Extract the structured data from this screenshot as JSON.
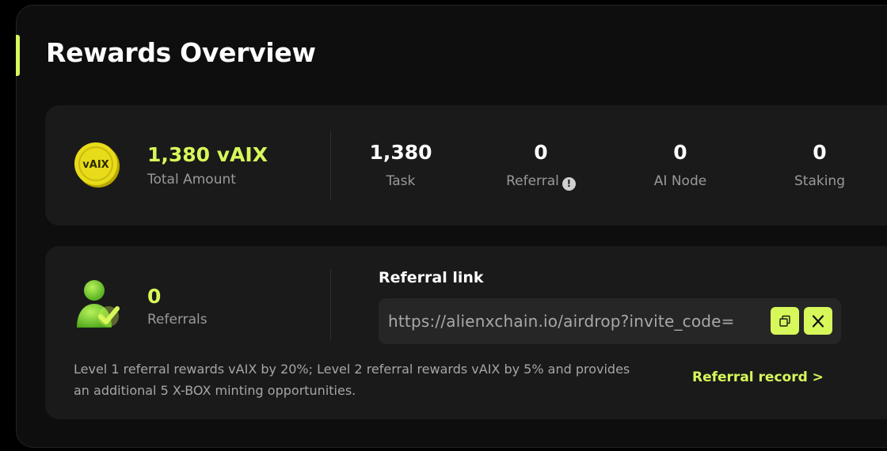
{
  "page": {
    "title": "Rewards Overview"
  },
  "rewards": {
    "total_amount": "1,380 vAIX",
    "total_label": "Total Amount",
    "coin_text": "vAIX",
    "stats": [
      {
        "value": "1,380",
        "label": "Task"
      },
      {
        "value": "0",
        "label": "Referral"
      },
      {
        "value": "0",
        "label": "AI Node"
      },
      {
        "value": "0",
        "label": "Staking"
      }
    ]
  },
  "referral": {
    "count": "0",
    "count_label": "Referrals",
    "link_title": "Referral link",
    "link_value": "https://alienxchain.io/airdrop?invite_code=",
    "description": "Level 1 referral rewards vAIX by 20%; Level 2 referral rewards vAIX by 5% and provides an additional 5 X-BOX minting opportunities.",
    "record_label": "Referral record >"
  },
  "icons": {
    "info": "info-icon",
    "copy": "copy-icon",
    "x_share": "x-logo-icon",
    "coin": "vaix-coin-icon",
    "referrals": "user-check-icon"
  },
  "colors": {
    "accent": "#d7f85a",
    "panel": "#0e0e0e",
    "card": "#1a1a1a"
  }
}
